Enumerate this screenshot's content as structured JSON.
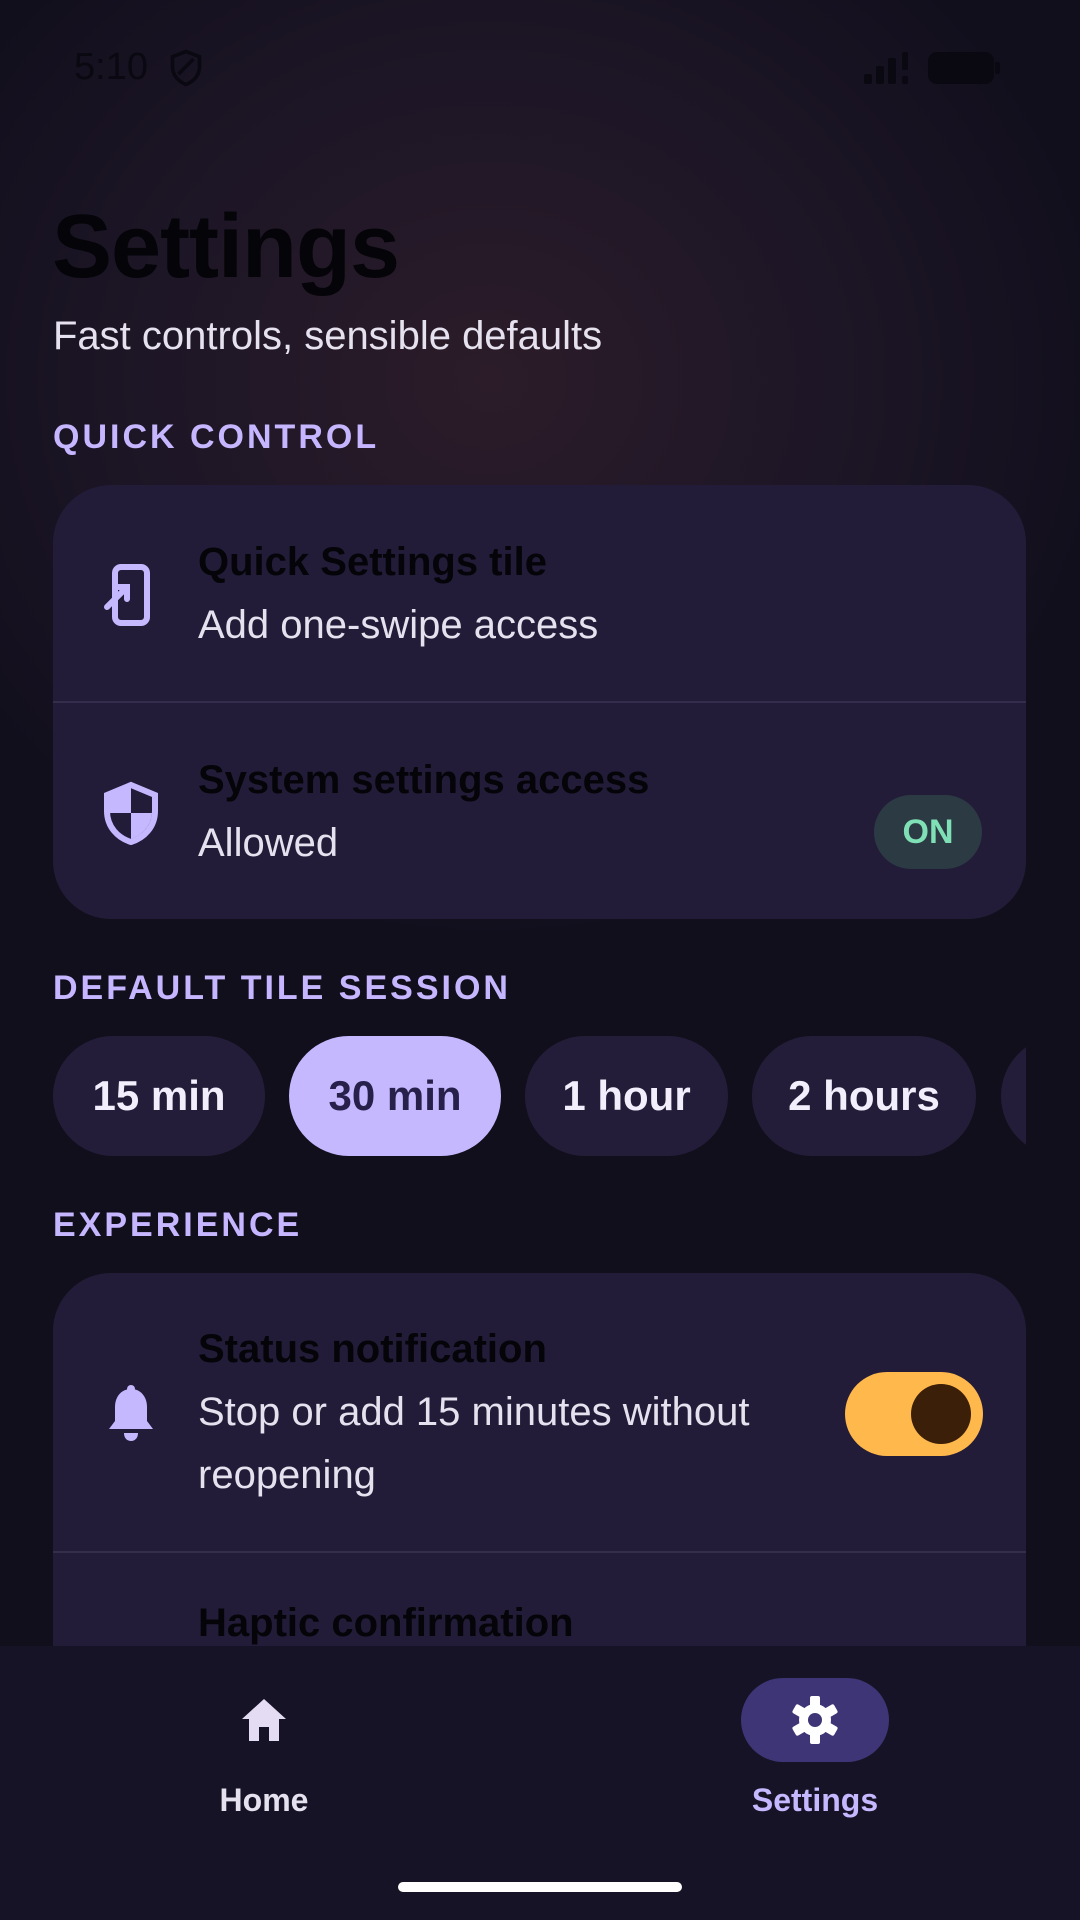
{
  "status_bar": {
    "time": "5:10"
  },
  "header": {
    "title": "Settings",
    "subtitle": "Fast controls, sensible defaults"
  },
  "quick_control": {
    "section_label": "QUICK CONTROL",
    "items": [
      {
        "title": "Quick Settings tile",
        "subtitle": "Add one-swipe access",
        "icon": "phone-add-icon"
      },
      {
        "title": "System settings access",
        "subtitle": "Allowed",
        "icon": "shield-icon",
        "badge": "ON"
      }
    ]
  },
  "default_tile_session": {
    "section_label": "DEFAULT TILE SESSION",
    "options": [
      "15 min",
      "30 min",
      "1 hour",
      "2 hours"
    ],
    "selected": "30 min"
  },
  "experience": {
    "section_label": "EXPERIENCE",
    "items": [
      {
        "title": "Status notification",
        "subtitle": "Stop or add 15 minutes without reopening",
        "icon": "bell-icon",
        "toggle_on": true
      },
      {
        "title": "Haptic confirmation"
      }
    ]
  },
  "bottom_nav": {
    "items": [
      {
        "label": "Home",
        "icon": "home-icon",
        "active": false
      },
      {
        "label": "Settings",
        "icon": "gear-icon",
        "active": true
      }
    ]
  },
  "colors": {
    "accent": "#c6b8ff",
    "card": "#221c38",
    "toggle_on": "#ffb84b",
    "badge_text": "#7fe0b6"
  }
}
